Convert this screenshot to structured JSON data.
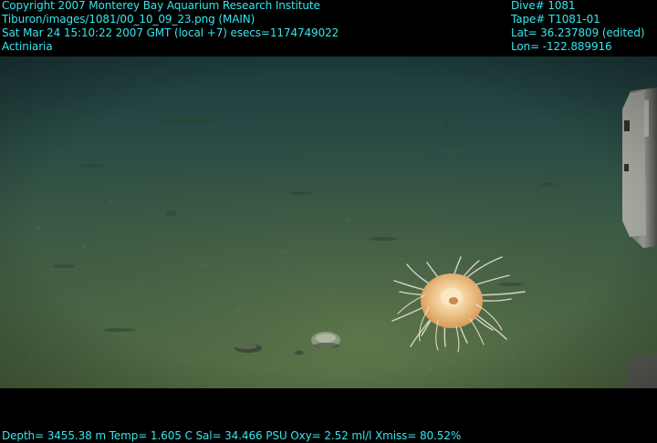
{
  "header_left": {
    "line1": "Copyright 2007 Monterey Bay Aquarium Research Institute",
    "line2": "Tiburon/images/1081/00_10_09_23.png (MAIN)",
    "line3": "Sat Mar 24 15:10:22 2007 GMT (local +7)  esecs=1174749022",
    "line4": "Actiniaria"
  },
  "header_right": {
    "line1": "Dive# 1081",
    "line2": "Tape# T1081-01",
    "line3": "Lat= 36.237809 (edited)",
    "line4": "Lon= -122.889916"
  },
  "footer": {
    "line1": "Depth= 3455.38 m  Temp= 1.605 C  Sal= 34.466 PSU  Oxy= 2.52 ml/l  Xmiss= 80.52%"
  },
  "colors": {
    "overlay_text": "#35e6ee",
    "frame_background": "#000000",
    "water_top": "#1f3f3f",
    "seafloor": "#4f6a43",
    "anemone": "#f2d2a4"
  },
  "scene": {
    "subject_icon": "sea-anemone",
    "equipment_icon": "vehicle-arm"
  }
}
